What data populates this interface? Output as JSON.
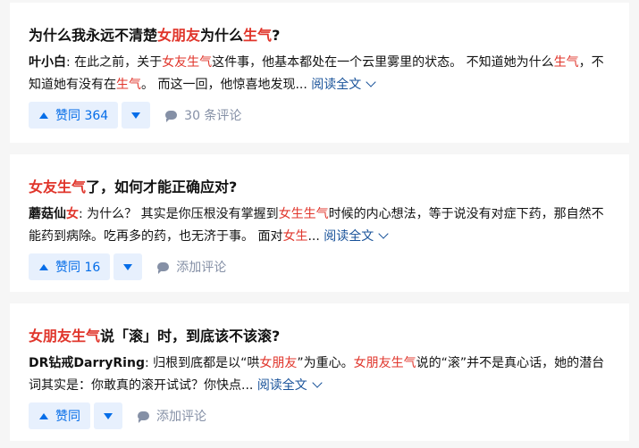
{
  "answers": [
    {
      "title": {
        "pre": "为什么我永远不清楚",
        "hl1": "女朋友",
        "mid": "为什么",
        "hl2": "生气",
        "post": "?"
      },
      "excerpt": {
        "author": "叶小白",
        "parts": [
          ": 在此之前，关于",
          "女友生气",
          "这件事，他基本都处在一个云里雾里的状态。 不知道她为什么",
          "生气",
          "，不知道她有没有在",
          "生气",
          "。 而这一回，他惊喜地发现..."
        ]
      },
      "read_more": "阅读全文",
      "upvote_label": "赞同 364",
      "comment_label": "30 条评论"
    },
    {
      "title": {
        "hl1": "女友生气",
        "post": "了，如何才能正确应对?"
      },
      "excerpt": {
        "author": "蘑菇仙",
        "author_hl": "女",
        "parts": [
          ": 为什么？ 其实是你压根没有掌握到",
          "女生生气",
          "时候的内心想法，等于说没有对症下药，那自然不能药到病除。吃再多的药，也无济于事。 面对",
          "女生",
          "..."
        ]
      },
      "read_more": "阅读全文",
      "upvote_label": "赞同 16",
      "comment_label": "添加评论"
    },
    {
      "title": {
        "hl1": "女朋友生气",
        "post": "说「滚」时，到底该不该滚?"
      },
      "excerpt": {
        "author": "DR钻戒DarryRing",
        "parts": [
          ": 归根到底都是以“哄",
          "女朋友",
          "”为重心。",
          "女朋友生气",
          "说的“滚”并不是真心话，她的潜台词其实是：你敢真的滚开试试？你快点..."
        ]
      },
      "read_more": "阅读全文",
      "upvote_label": "赞同",
      "comment_label": "添加评论"
    }
  ],
  "colors": {
    "highlight": "#e0352b",
    "link": "#175199",
    "vote": "#056de8",
    "muted": "#8590a6"
  },
  "icons": {
    "upvote": "triangle-up-icon",
    "downvote": "triangle-down-icon",
    "comment": "comment-bubble-icon",
    "expand": "chevron-down-icon"
  }
}
